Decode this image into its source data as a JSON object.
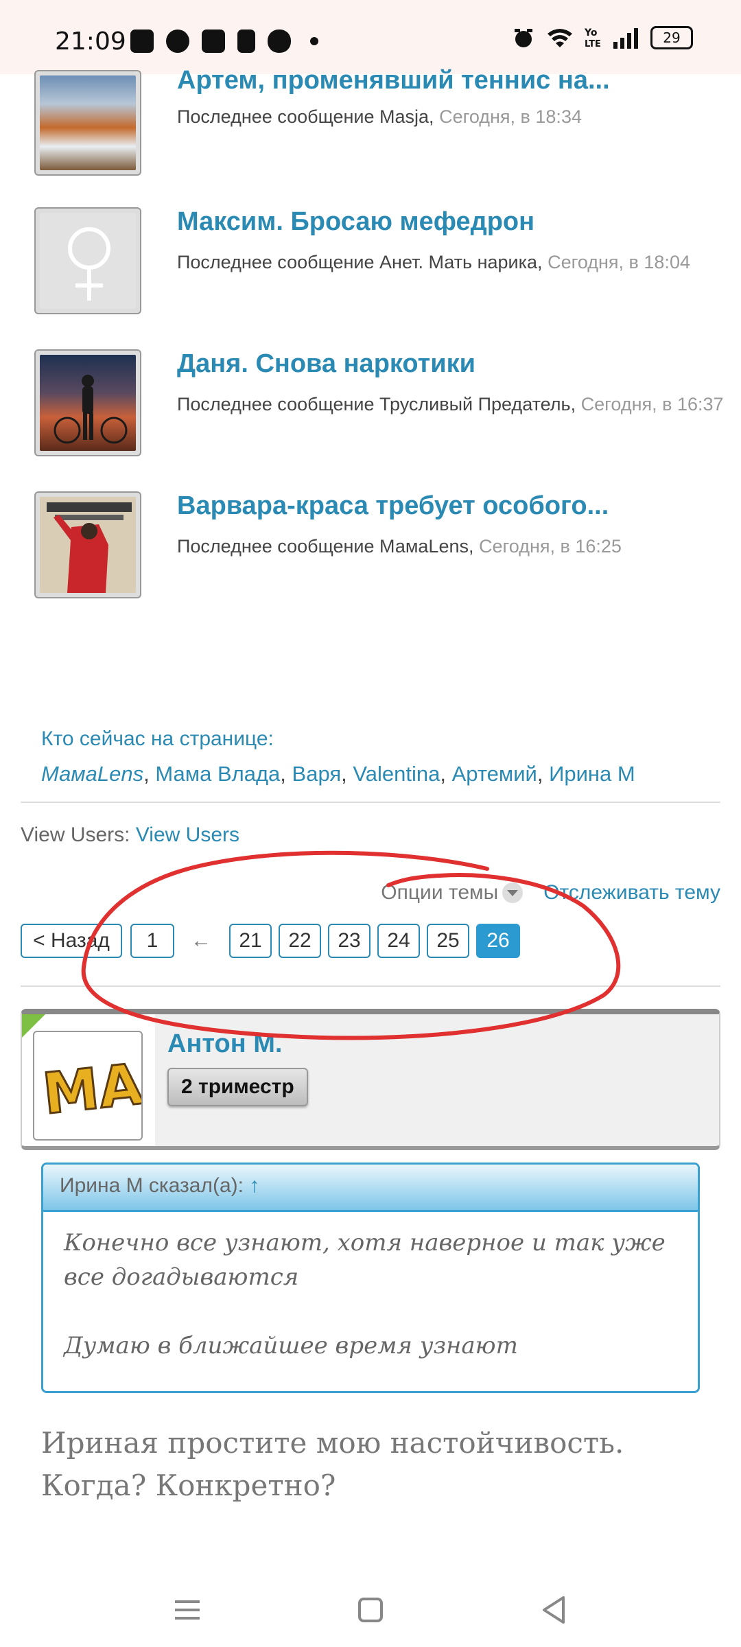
{
  "status_bar": {
    "time": "21:09",
    "battery": "29",
    "icons_left": [
      "shield-icon",
      "app-icon",
      "mail-icon",
      "ok-icon",
      "cloud-icon",
      "dot-icon"
    ],
    "icons_right": [
      "alarm-icon",
      "wifi-icon",
      "volte-icon",
      "signal-icon",
      "battery-icon"
    ]
  },
  "topics": [
    {
      "title": "Артем, променявший теннис на...",
      "meta_prefix": "Последнее сообщение Masja,",
      "date": "Сегодня, в 18:34"
    },
    {
      "title": "Максим. Бросаю мефедрон",
      "meta_prefix": "Последнее сообщение Анет. Мать нарика,",
      "date": "Сегодня, в 18:04"
    },
    {
      "title": "Даня. Снова наркотики",
      "meta_prefix": "Последнее сообщение Трусливый Предатель,",
      "date": "Сегодня, в 16:37"
    },
    {
      "title": "Варвара-краса требует особого...",
      "meta_prefix": "Последнее сообщение МамаLens,",
      "date": "Сегодня, в 16:25"
    }
  ],
  "online": {
    "heading": "Кто сейчас на странице:",
    "users": [
      "МамаLens",
      "Мама Влада",
      "Варя",
      "Valentina",
      "Артемий",
      "Ирина М"
    ],
    "separator": ", "
  },
  "view_users": {
    "label": "View Users:",
    "link": "View Users"
  },
  "thread_tools": {
    "options": "Опции темы",
    "watch": "Отслеживать тему"
  },
  "pagination": {
    "prev": "< Назад",
    "first": "1",
    "ellipsis_arrow": "←",
    "pages": [
      "21",
      "22",
      "23",
      "24",
      "25"
    ],
    "current": "26"
  },
  "post": {
    "author": "Антон М.",
    "rank": "2 триместр",
    "avatar_text": "МА",
    "quote": {
      "author": "Ирина М сказал(а):",
      "arrow": "↑",
      "lines": [
        "Конечно все узнают, хотя наверное и так уже все догадываются",
        "Думаю в ближайшее время узнают"
      ]
    },
    "text": "Ириная простите мою настойчивость. Когда? Конкретно?"
  },
  "colors": {
    "link": "#2a8ab3",
    "current_page": "#2a9ad0",
    "annotation": "#e03030",
    "online_badge": "#7ec043"
  }
}
